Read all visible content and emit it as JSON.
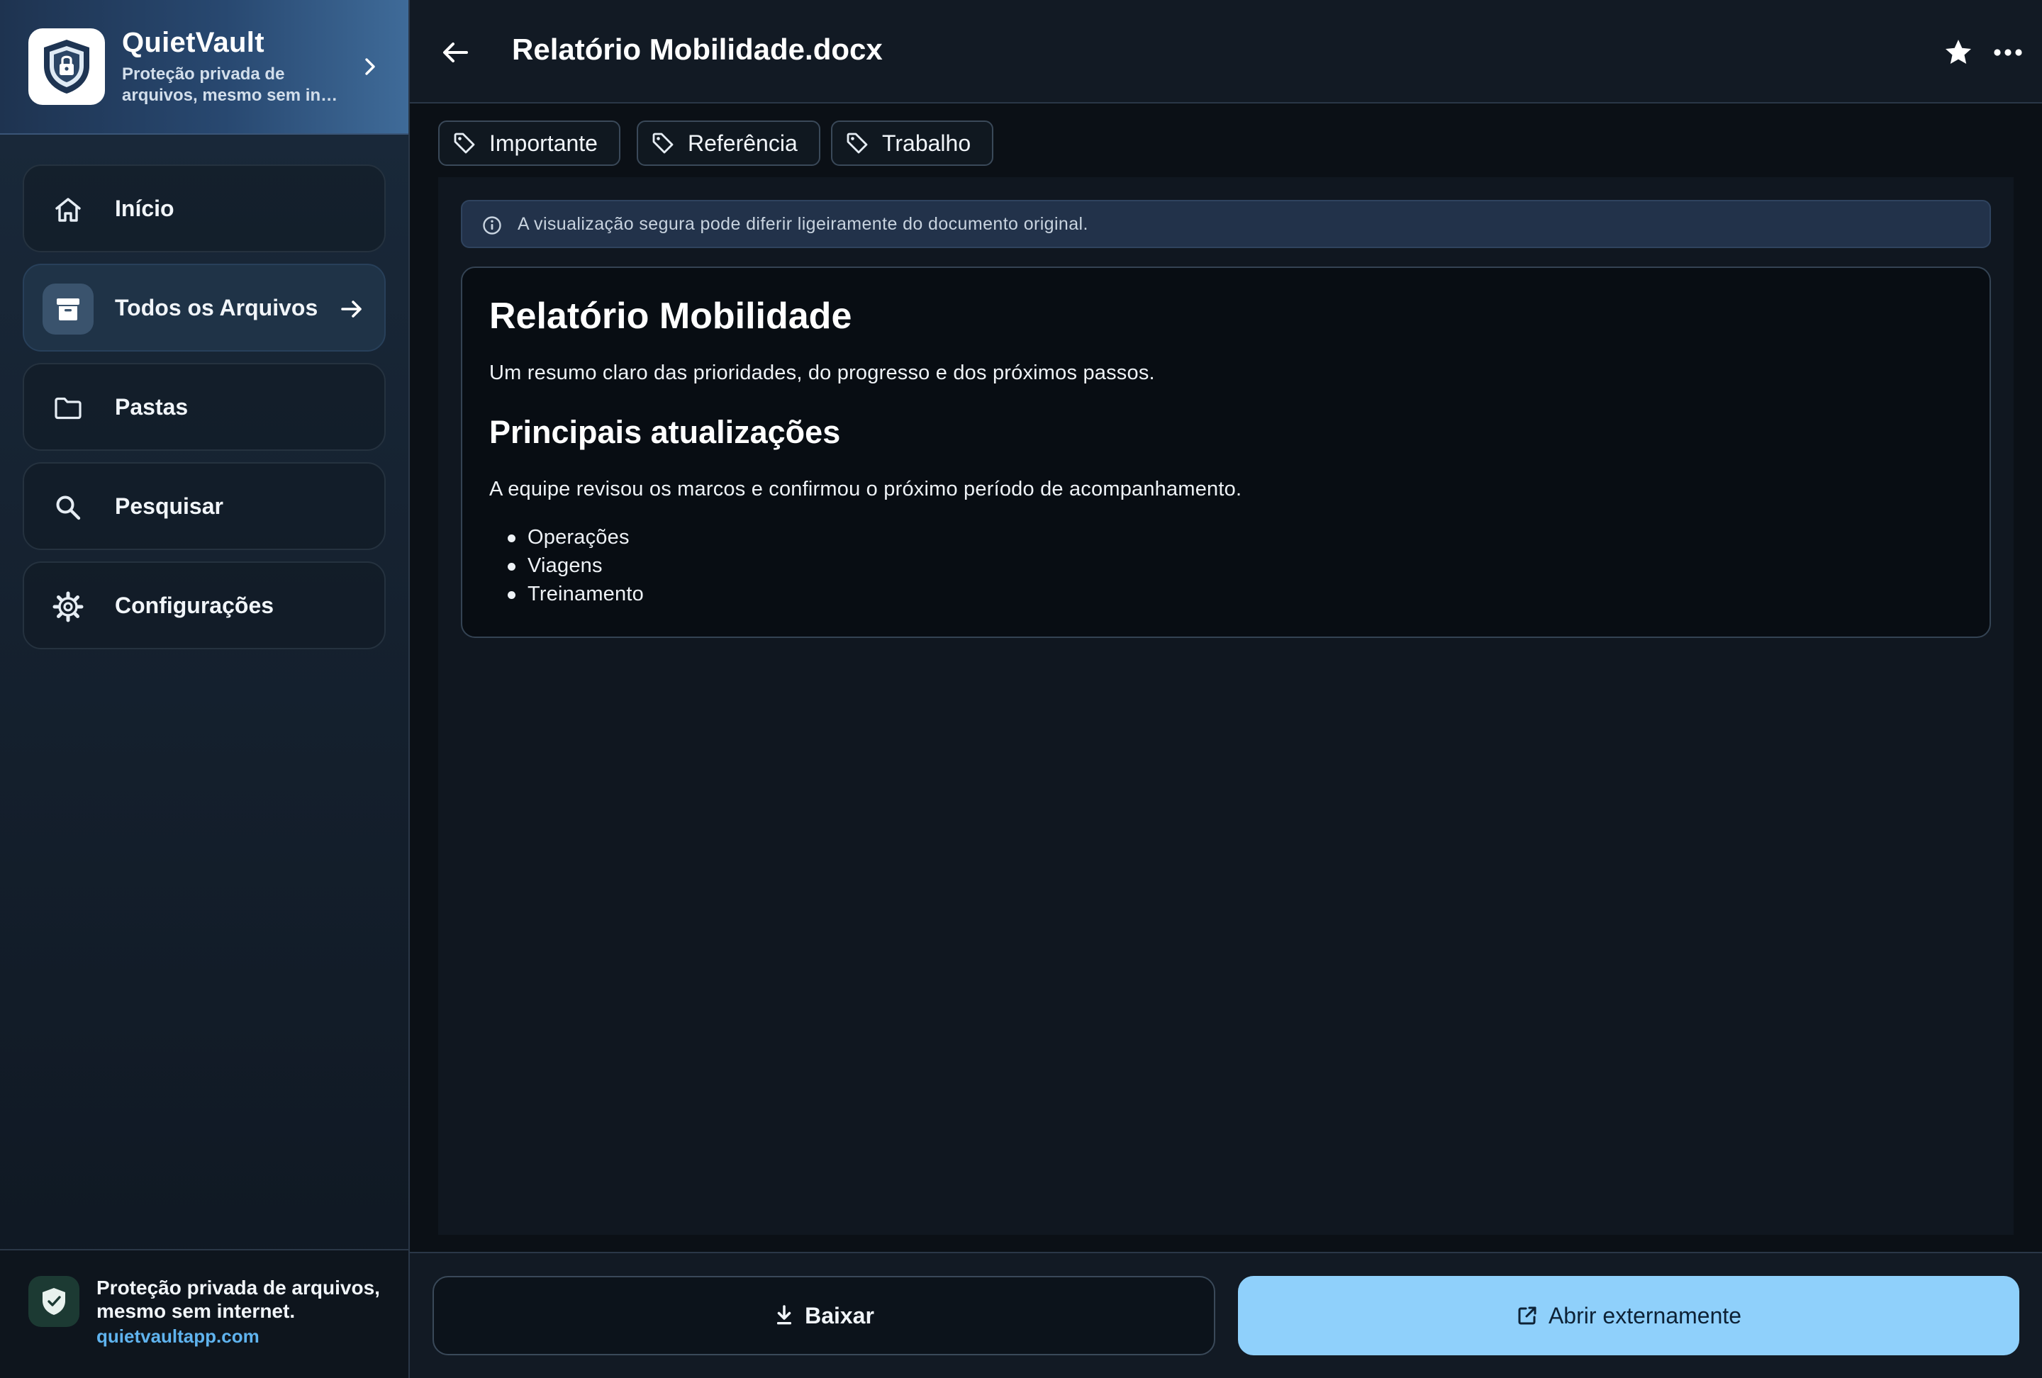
{
  "brand": {
    "name": "QuietVault",
    "tagline": "Proteção privada de arquivos, mesmo sem in…"
  },
  "nav": {
    "items": [
      {
        "label": "Início",
        "icon": "home-icon",
        "active": false
      },
      {
        "label": "Todos os Arquivos",
        "icon": "archive-box-icon",
        "active": true
      },
      {
        "label": "Pastas",
        "icon": "folder-icon",
        "active": false
      },
      {
        "label": "Pesquisar",
        "icon": "search-icon",
        "active": false
      },
      {
        "label": "Configurações",
        "icon": "gear-icon",
        "active": false
      }
    ]
  },
  "footer": {
    "text": "Proteção privada de arquivos, mesmo sem internet.",
    "link": "quietvaultapp.com",
    "icon": "shield-check-icon"
  },
  "header": {
    "title": "Relatório Mobilidade.docx",
    "back_icon": "arrow-left-icon",
    "star_icon": "star-icon",
    "more_icon": "more-horizontal-icon"
  },
  "tags": [
    {
      "label": "Importante"
    },
    {
      "label": "Referência"
    },
    {
      "label": "Trabalho"
    }
  ],
  "viewer": {
    "notice": "A visualização segura pode diferir ligeiramente do documento original.",
    "document": {
      "heading": "Relatório Mobilidade",
      "intro": "Um resumo claro das prioridades, do progresso e dos próximos passos.",
      "subheading": "Principais atualizações",
      "paragraph": "A equipe revisou os marcos e confirmou o próximo período de acompanhamento.",
      "bullets": [
        "Operações",
        "Viagens",
        "Treinamento"
      ]
    }
  },
  "actions": {
    "download_label": "Baixar",
    "open_external_label": "Abrir externamente"
  },
  "colors": {
    "accent": "#8fd0fb",
    "link": "#5fb3ee",
    "sidebar_bg": "#15212f",
    "main_bg": "#0b1016"
  }
}
